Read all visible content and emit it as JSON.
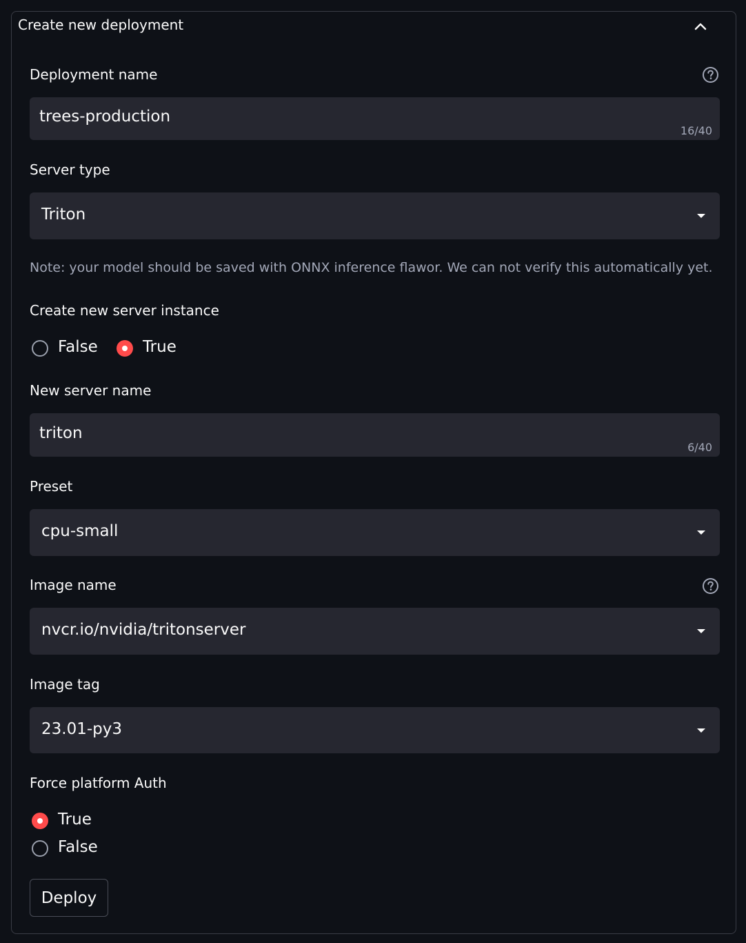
{
  "expander": {
    "title": "Create new deployment",
    "expanded": true
  },
  "deployment_name": {
    "label": "Deployment name",
    "value": "trees-production",
    "counter": "16/40"
  },
  "server_type": {
    "label": "Server type",
    "selected": "Triton"
  },
  "note": "Note: your model should be saved with ONNX inference flawor. We can not verify this automatically yet.",
  "create_server_instance": {
    "label": "Create new server instance",
    "options": [
      "False",
      "True"
    ],
    "selected": "True"
  },
  "new_server_name": {
    "label": "New server name",
    "value": "triton",
    "counter": "6/40"
  },
  "preset": {
    "label": "Preset",
    "selected": "cpu-small"
  },
  "image_name": {
    "label": "Image name",
    "selected": "nvcr.io/nvidia/tritonserver"
  },
  "image_tag": {
    "label": "Image tag",
    "selected": "23.01-py3"
  },
  "force_platform_auth": {
    "label": "Force platform Auth",
    "options": [
      "True",
      "False"
    ],
    "selected": "True"
  },
  "deploy_button": {
    "label": "Deploy"
  },
  "colors": {
    "background": "#0e1117",
    "input_bg": "#262730",
    "accent": "#ff4b4b",
    "muted_text": "#a3a8b8",
    "border": "#3a3d46"
  },
  "icons": {
    "collapse": "chevron-up-icon",
    "help": "help-circle-icon",
    "dropdown": "caret-down-icon"
  }
}
